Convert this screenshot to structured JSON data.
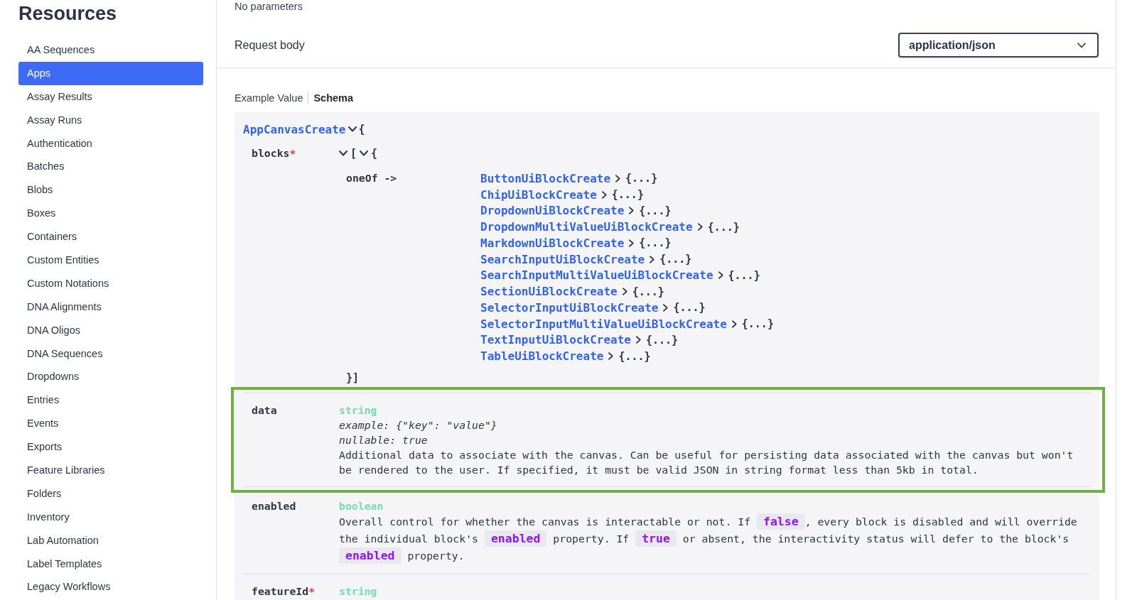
{
  "top_note": "No parameters",
  "sidebar": {
    "title": "Resources",
    "items": [
      {
        "label": "AA Sequences",
        "selected": false
      },
      {
        "label": "Apps",
        "selected": true
      },
      {
        "label": "Assay Results",
        "selected": false
      },
      {
        "label": "Assay Runs",
        "selected": false
      },
      {
        "label": "Authentication",
        "selected": false
      },
      {
        "label": "Batches",
        "selected": false
      },
      {
        "label": "Blobs",
        "selected": false
      },
      {
        "label": "Boxes",
        "selected": false
      },
      {
        "label": "Containers",
        "selected": false
      },
      {
        "label": "Custom Entities",
        "selected": false
      },
      {
        "label": "Custom Notations",
        "selected": false
      },
      {
        "label": "DNA Alignments",
        "selected": false
      },
      {
        "label": "DNA Oligos",
        "selected": false
      },
      {
        "label": "DNA Sequences",
        "selected": false
      },
      {
        "label": "Dropdowns",
        "selected": false
      },
      {
        "label": "Entries",
        "selected": false
      },
      {
        "label": "Events",
        "selected": false
      },
      {
        "label": "Exports",
        "selected": false
      },
      {
        "label": "Feature Libraries",
        "selected": false
      },
      {
        "label": "Folders",
        "selected": false
      },
      {
        "label": "Inventory",
        "selected": false
      },
      {
        "label": "Lab Automation",
        "selected": false
      },
      {
        "label": "Label Templates",
        "selected": false
      },
      {
        "label": "Legacy Workflows",
        "selected": false
      }
    ]
  },
  "request_body": {
    "label": "Request body",
    "content_type": "application/json"
  },
  "schema_tabs": [
    {
      "label": "Example Value",
      "selected": false
    },
    {
      "label": "Schema",
      "selected": true
    }
  ],
  "model": {
    "name": "AppCanvasCreate",
    "expanded": true,
    "open": "{",
    "properties": [
      {
        "kind": "array",
        "name": "blocks",
        "required_mark": "*",
        "expanded": true,
        "open": "[",
        "items_expanded": true,
        "items_open": "{",
        "one_of_label": "oneOf ->",
        "options": [
          {
            "name": "ButtonUiBlockCreate",
            "expanded": false,
            "summary": "{...}"
          },
          {
            "name": "ChipUiBlockCreate",
            "expanded": false,
            "summary": "{...}"
          },
          {
            "name": "DropdownUiBlockCreate",
            "expanded": false,
            "summary": "{...}"
          },
          {
            "name": "DropdownMultiValueUiBlockCreate",
            "expanded": false,
            "summary": "{...}"
          },
          {
            "name": "MarkdownUiBlockCreate",
            "expanded": false,
            "summary": "{...}"
          },
          {
            "name": "SearchInputUiBlockCreate",
            "expanded": false,
            "summary": "{...}"
          },
          {
            "name": "SearchInputMultiValueUiBlockCreate",
            "expanded": false,
            "summary": "{...}"
          },
          {
            "name": "SectionUiBlockCreate",
            "expanded": false,
            "summary": "{...}"
          },
          {
            "name": "SelectorInputUiBlockCreate",
            "expanded": false,
            "summary": "{...}"
          },
          {
            "name": "SelectorInputMultiValueUiBlockCreate",
            "expanded": false,
            "summary": "{...}"
          },
          {
            "name": "TextInputUiBlockCreate",
            "expanded": false,
            "summary": "{...}"
          },
          {
            "name": "TableUiBlockCreate",
            "expanded": false,
            "summary": "{...}"
          }
        ],
        "close": "}]",
        "highlighted": false
      },
      {
        "kind": "field",
        "name": "data",
        "type": "string",
        "example": "example: {\"key\": \"value\"}",
        "nullable": "nullable: true",
        "description": [
          {
            "kind": "text",
            "text": "Additional data to associate with the canvas. Can be useful for persisting data associated with the canvas but won't be rendered to the user. If specified, it must be valid JSON in string format less than 5kb in total."
          }
        ],
        "highlighted": true
      },
      {
        "kind": "field",
        "name": "enabled",
        "type": "boolean",
        "description": [
          {
            "kind": "text",
            "text": "Overall control for whether the canvas is interactable or not. If "
          },
          {
            "kind": "code",
            "text": "false"
          },
          {
            "kind": "text",
            "text": ", every block is disabled and will override the individual block's "
          },
          {
            "kind": "code",
            "text": "enabled"
          },
          {
            "kind": "text",
            "text": " property. If "
          },
          {
            "kind": "code",
            "text": "true"
          },
          {
            "kind": "text",
            "text": " or absent, the interactivity status will defer to the block's "
          },
          {
            "kind": "code",
            "text": "enabled"
          },
          {
            "kind": "text",
            "text": " property."
          }
        ],
        "highlighted": false
      },
      {
        "kind": "field",
        "name": "featureId",
        "required_mark": "*",
        "type": "string",
        "highlighted": false
      }
    ]
  }
}
